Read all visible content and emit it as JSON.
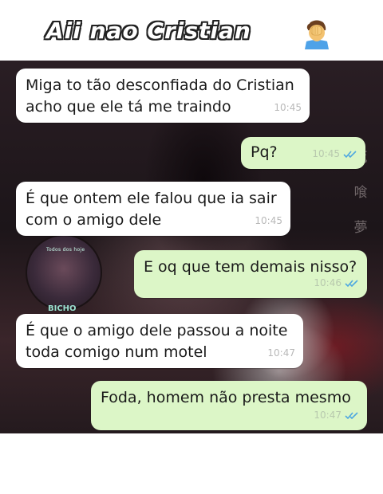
{
  "header": {
    "title": "Aii nao Cristian",
    "emoji": "facepalm-emoji"
  },
  "background": {
    "watermark_kanji": [
      "死",
      "喰",
      "夢"
    ],
    "avatar_caption": "Todos dos hoje",
    "avatar_name": "BICHO"
  },
  "colors": {
    "incoming_bubble": "#ffffff",
    "outgoing_bubble": "#dcf6c7",
    "read_ticks": "#4fa8e0"
  },
  "messages": [
    {
      "direction": "incoming",
      "text": "Miga to tão desconfiada do Cristian\nacho que ele tá me traindo",
      "time": "10:45"
    },
    {
      "direction": "outgoing",
      "text": "Pq?",
      "time": "10:45",
      "status": "read"
    },
    {
      "direction": "incoming",
      "text": "É que ontem ele falou que ia sair\ncom o amigo dele",
      "time": "10:45"
    },
    {
      "direction": "outgoing",
      "text": "E oq que tem demais nisso?",
      "time": "10:46",
      "status": "read"
    },
    {
      "direction": "incoming",
      "text": "É que o amigo dele passou a noite\ntoda comigo num motel",
      "time": "10:47"
    },
    {
      "direction": "outgoing",
      "text": "Foda, homem não presta mesmo",
      "time": "10:47",
      "status": "read"
    }
  ]
}
